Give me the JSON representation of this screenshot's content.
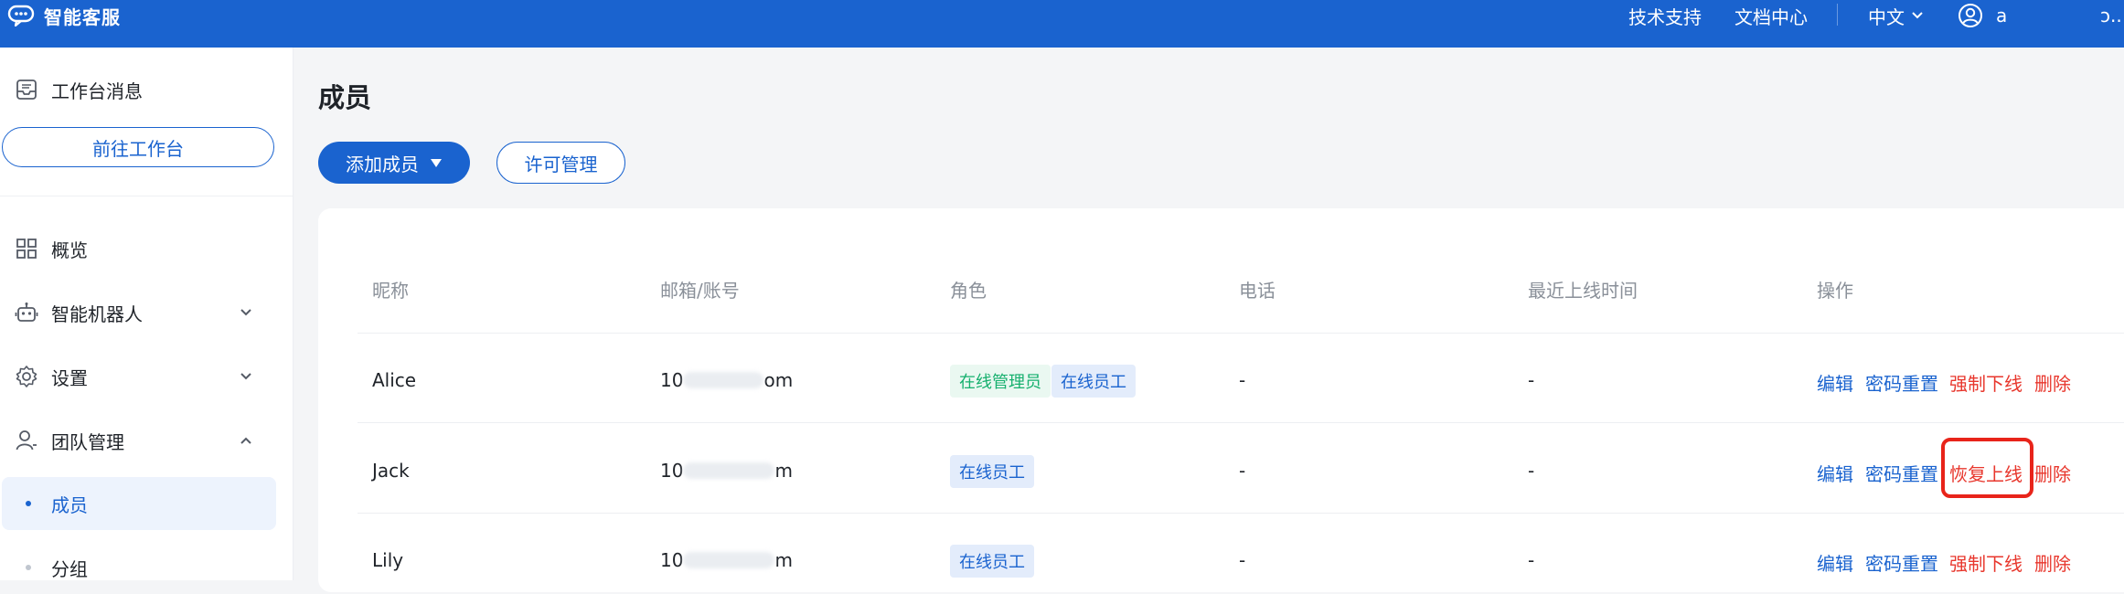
{
  "colors": {
    "brand": "#1a63cf",
    "danger": "#e8372d",
    "success": "#16b06e"
  },
  "topbar": {
    "brand_icon": "chat-bubble-icon",
    "brand_name": "智能客服",
    "links": [
      "技术支持",
      "文档中心"
    ],
    "language": "中文",
    "user_icon": "user-circle-icon",
    "user_name": "a",
    "user_tail": "ɔ.."
  },
  "sidebar": {
    "workbench_message": "工作台消息",
    "goto_workbench": "前往工作台",
    "overview": "概览",
    "robot": "智能机器人",
    "settings": "设置",
    "team": "团队管理",
    "team_children": [
      "成员",
      "分组"
    ]
  },
  "main": {
    "title": "成员",
    "add_member": "添加成员",
    "license_manage": "许可管理",
    "columns": [
      "昵称",
      "邮箱/账号",
      "角色",
      "电话",
      "最近上线时间",
      "操作"
    ],
    "rows": [
      {
        "name": "Alice",
        "email_start": "10",
        "email_end": "om",
        "roles": [
          "在线管理员",
          "在线员工"
        ],
        "phone": "-",
        "last_online": "-",
        "actions": [
          "编辑",
          "密码重置",
          "强制下线",
          "删除"
        ]
      },
      {
        "name": "Jack",
        "email_start": "10",
        "email_end": "m",
        "roles": [
          "在线员工"
        ],
        "phone": "-",
        "last_online": "-",
        "actions": [
          "编辑",
          "密码重置",
          "恢复上线",
          "删除"
        ]
      },
      {
        "name": "Lily",
        "email_start": "10",
        "email_end": "m",
        "roles": [
          "在线员工"
        ],
        "phone": "-",
        "last_online": "-",
        "actions": [
          "编辑",
          "密码重置",
          "强制下线",
          "删除"
        ]
      }
    ]
  }
}
